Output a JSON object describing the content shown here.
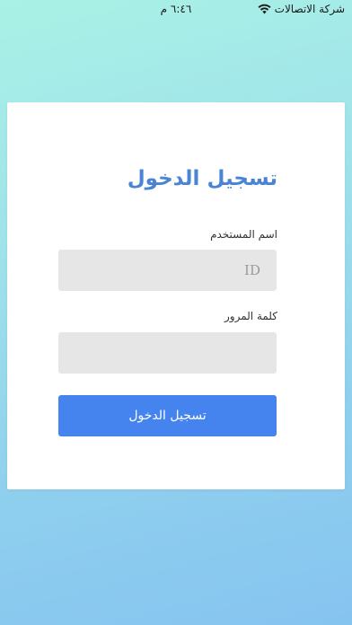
{
  "status_bar": {
    "carrier": "شركة الاتصالات",
    "time": "٦:٤٦ م",
    "wifi_icon": "wifi-icon"
  },
  "login": {
    "title": "تسجيل الدخول",
    "username_label": "اسم المستخدم",
    "username_placeholder": "ID",
    "username_value": "",
    "password_label": "كلمة المرور",
    "password_placeholder": "",
    "password_value": "",
    "submit_label": "تسجيل الدخول"
  },
  "colors": {
    "accent": "#4a84d4",
    "button": "#4584ef",
    "field_bg": "#e6e6e6"
  }
}
